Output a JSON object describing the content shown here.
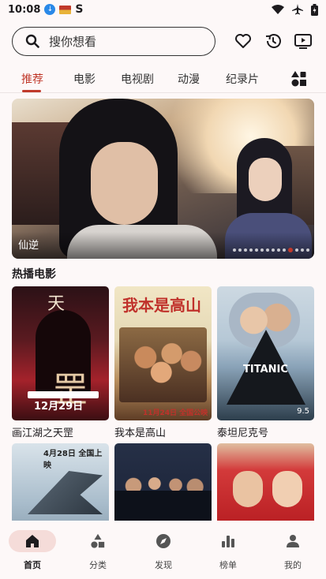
{
  "status_bar": {
    "time": "10:08"
  },
  "search": {
    "placeholder": "搜你想看"
  },
  "tabs": [
    {
      "label": "推荐",
      "active": true
    },
    {
      "label": "电影"
    },
    {
      "label": "电视剧"
    },
    {
      "label": "动漫"
    },
    {
      "label": "纪录片"
    }
  ],
  "banner": {
    "title": "仙逆",
    "slides": 14,
    "current_slide": 11
  },
  "section": {
    "title": "热播电影"
  },
  "movies": [
    {
      "title": "画江湖之天罡",
      "poster_date": "12月29日"
    },
    {
      "title": "我本是高山",
      "poster_title": "我本是高山",
      "poster_date": "11月24日 全国公映"
    },
    {
      "title": "泰坦尼克号",
      "poster_title": "TITANIC",
      "rating": "9.5"
    },
    {
      "title": "",
      "poster_date": "4月28日 全国上映"
    },
    {
      "title": ""
    },
    {
      "title": ""
    }
  ],
  "bottom_nav": [
    {
      "label": "首页",
      "icon": "home-icon",
      "active": true
    },
    {
      "label": "分类",
      "icon": "category-icon"
    },
    {
      "label": "发现",
      "icon": "compass-icon"
    },
    {
      "label": "榜单",
      "icon": "chart-icon"
    },
    {
      "label": "我的",
      "icon": "person-icon"
    }
  ],
  "colors": {
    "accent": "#c0392b",
    "background": "#fdf8f8",
    "nav_active_bg": "#f5dcd9"
  }
}
